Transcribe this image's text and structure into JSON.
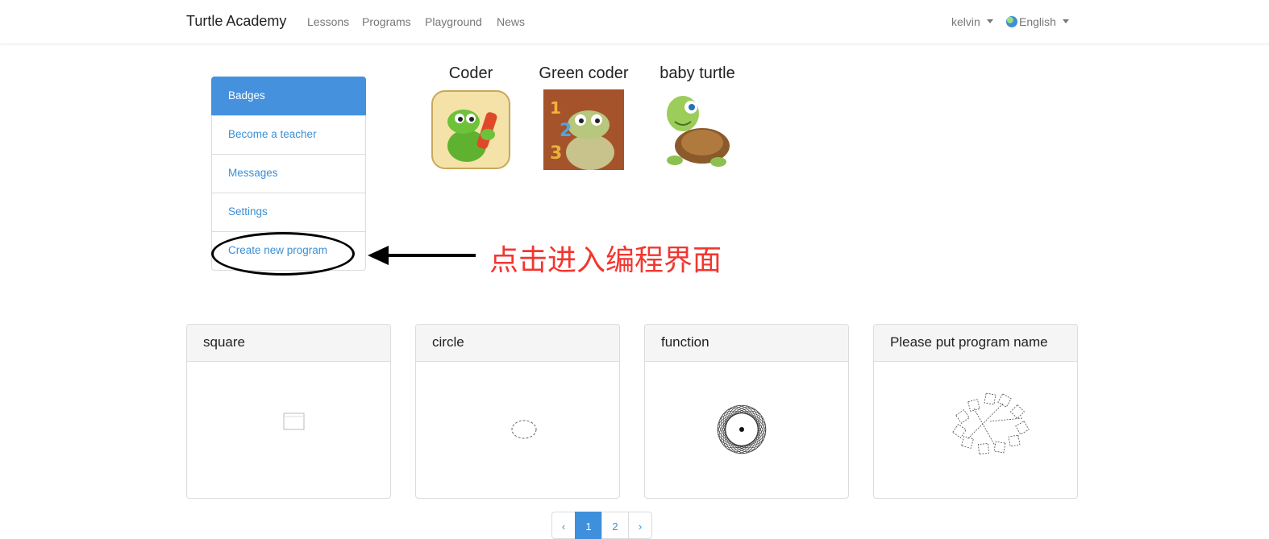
{
  "navbar": {
    "brand": "Turtle Academy",
    "links": [
      "Lessons",
      "Programs",
      "Playground",
      "News"
    ],
    "user": "kelvin",
    "language": "English"
  },
  "sidebar": {
    "items": [
      {
        "label": "Badges",
        "active": true
      },
      {
        "label": "Become a teacher",
        "active": false
      },
      {
        "label": "Messages",
        "active": false
      },
      {
        "label": "Settings",
        "active": false
      },
      {
        "label": "Create new program",
        "active": false
      }
    ]
  },
  "badges": [
    {
      "title": "Coder",
      "icon": "turtle-with-crayon-icon"
    },
    {
      "title": "Green coder",
      "icon": "turtle-with-numbers-icon"
    },
    {
      "title": "baby turtle",
      "icon": "baby-turtle-icon"
    }
  ],
  "annotation": {
    "text": "点击进入编程界面",
    "color": "#f2362f"
  },
  "programs": [
    {
      "name": "square",
      "thumbnail": "square-drawing"
    },
    {
      "name": "circle",
      "thumbnail": "circle-drawing"
    },
    {
      "name": "function",
      "thumbnail": "spirograph-drawing"
    },
    {
      "name": "Please put program name",
      "thumbnail": "rotated-squares-drawing"
    }
  ],
  "pagination": {
    "prev": "‹",
    "pages": [
      "1",
      "2"
    ],
    "current": "1",
    "next": "›"
  },
  "colors": {
    "accent": "#4591dd",
    "link": "#3a8fd6",
    "annotation": "#f2362f"
  }
}
